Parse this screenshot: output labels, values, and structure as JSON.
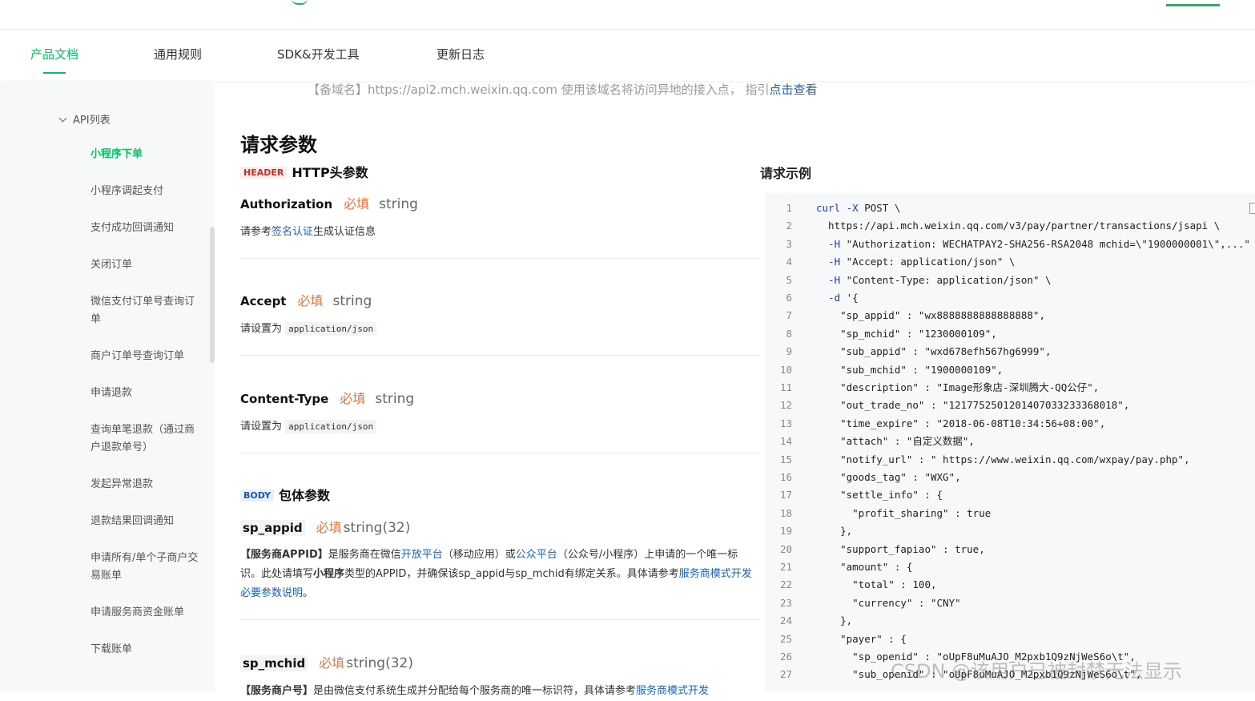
{
  "nav": {
    "tabs": [
      "产品文档",
      "通用规则",
      "SDK&开发工具",
      "更新日志"
    ]
  },
  "sidebar": {
    "group": "API列表",
    "items": [
      "小程序下单",
      "小程序调起支付",
      "支付成功回调通知",
      "关闭订单",
      "微信支付订单号查询订单",
      "商户订单号查询订单",
      "申请退款",
      "查询单笔退款（通过商户退款单号）",
      "发起异常退款",
      "退款结果回调通知",
      "申请所有/单个子商户交易账单",
      "申请服务商资金账单",
      "下载账单"
    ]
  },
  "main": {
    "mirror_prefix": "【备域名】https://api2.mch.weixin.qq.com 使用该域名将访问异地的接入点， 指引",
    "mirror_link": "点击查看",
    "title": "请求参数",
    "header_section": {
      "tag": "HEADER",
      "label": "HTTP头参数"
    },
    "required_label": "必填",
    "params": [
      {
        "name": "Authorization",
        "type": "string",
        "desc_pre": "请参考",
        "desc_link": "签名认证",
        "desc_post": "生成认证信息"
      },
      {
        "name": "Accept",
        "type": "string",
        "desc_pre": "请设置为",
        "desc_code": "application/json"
      },
      {
        "name": "Content-Type",
        "type": "string",
        "desc_pre": "请设置为",
        "desc_code": "application/json"
      }
    ],
    "body_section": {
      "tag": "BODY",
      "label": "包体参数"
    },
    "body_params": [
      {
        "name": "sp_appid",
        "type": "string(32)",
        "desc_bold1": "【服务商APPID】",
        "desc_t1": "是服务商在微信",
        "desc_link1": "开放平台",
        "desc_t2": "（移动应用）或",
        "desc_link2": "公众平台",
        "desc_t3": "（公众号/小程序）上申请的一个唯一标识。此处请填写",
        "desc_bold2": "小程序",
        "desc_t4": "类型的APPID，并确保该sp_appid与sp_mchid有绑定关系。具体请参考",
        "desc_link3": "服务商模式开发必要参数说明",
        "desc_t5": "。"
      },
      {
        "name": "sp_mchid",
        "type": "string(32)",
        "desc_bold1": "【服务商户号】",
        "desc_t1": "是由微信支付系统生成并分配给每个服务商的唯一标识符，具体请参考",
        "desc_link1": "服务商模式开发"
      }
    ]
  },
  "example": {
    "title": "请求示例",
    "lines": [
      "curl -X POST \\",
      "  https://api.mch.weixin.qq.com/v3/pay/partner/transactions/jsapi \\",
      "  -H \"Authorization: WECHATPAY2-SHA256-RSA2048 mchid=\\\"1900000001\\\",...\"",
      "  -H \"Accept: application/json\" \\",
      "  -H \"Content-Type: application/json\" \\",
      "  -d '{",
      "    \"sp_appid\" : \"wx8888888888888888\",",
      "    \"sp_mchid\" : \"1230000109\",",
      "    \"sub_appid\" : \"wxd678efh567hg6999\",",
      "    \"sub_mchid\" : \"1900000109\",",
      "    \"description\" : \"Image形象店-深圳腾大-QQ公仔\",",
      "    \"out_trade_no\" : \"1217752501201407033233368018\",",
      "    \"time_expire\" : \"2018-06-08T10:34:56+08:00\",",
      "    \"attach\" : \"自定义数据\",",
      "    \"notify_url\" : \" https://www.weixin.qq.com/wxpay/pay.php\",",
      "    \"goods_tag\" : \"WXG\",",
      "    \"settle_info\" : {",
      "      \"profit_sharing\" : true",
      "    },",
      "    \"support_fapiao\" : true,",
      "    \"amount\" : {",
      "      \"total\" : 100,",
      "      \"currency\" : \"CNY\"",
      "    },",
      "    \"payer\" : {",
      "      \"sp_openid\" : \"oUpF8uMuAJO_M2pxb1Q9zNjWeS6o\\t\",",
      "      \"sub_openid\" : \"oUpF8uMuAJO_M2pxb1Q9zNjWeS6o\\t\","
    ]
  },
  "watermark": "CSDN @该用户已被封禁无法显示"
}
